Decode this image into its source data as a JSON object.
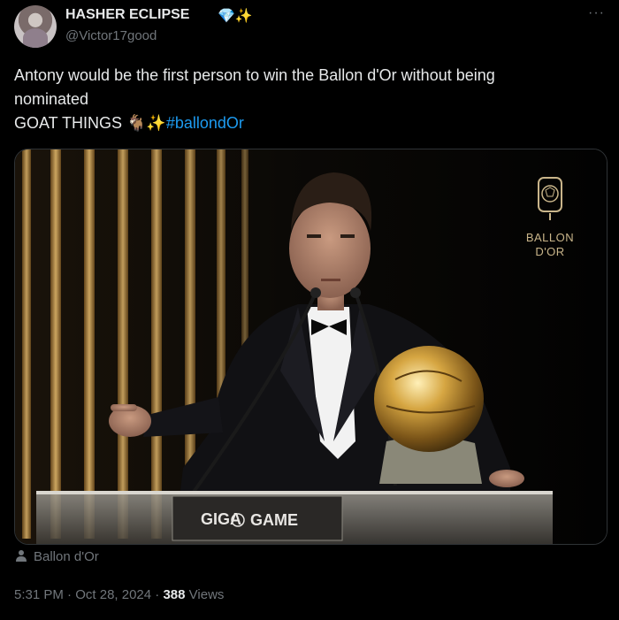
{
  "author": {
    "name": "HASHER ECLIPSE",
    "badges": "💎✨",
    "handle": "@Victor17good"
  },
  "menu": {
    "more_label": "···"
  },
  "tweet": {
    "line1": "Antony would be the first person to win the Ballon d'Or without being",
    "line2": "nominated",
    "line3_text": "GOAT THINGS 🐐✨",
    "hashtag": "#ballondOr"
  },
  "media": {
    "brand_line1": "BALLON",
    "brand_line2": "D'OR",
    "podium_left": "GIGA",
    "podium_right": "GAME"
  },
  "location": {
    "label": "Ballon d'Or"
  },
  "footer": {
    "time": "5:31 PM",
    "sep1": " · ",
    "date": "Oct 28, 2024",
    "sep2": " · ",
    "views_count": "388",
    "views_label": " Views"
  },
  "colors": {
    "hashtag": "#1d9bf0",
    "muted": "#71767b",
    "text": "#e7e9ea",
    "background": "#000000"
  }
}
